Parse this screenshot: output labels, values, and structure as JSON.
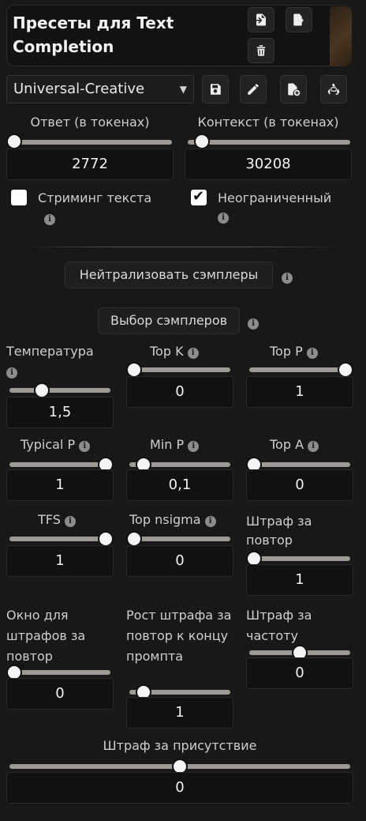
{
  "header": {
    "title": "Пресеты для Text Completion",
    "buttons": [
      "import-icon",
      "export-icon",
      "trash-icon"
    ]
  },
  "preset": {
    "selected": "Universal-Creative",
    "buttons": [
      "save-icon",
      "pencil-icon",
      "new-file-icon",
      "recycle-icon"
    ]
  },
  "response": {
    "label": "Ответ (в токенах)",
    "value": "2772",
    "fraction": 0.05
  },
  "context": {
    "label": "Контекст (в токенах)",
    "value": "30208",
    "fraction": 0.1
  },
  "checkboxes": {
    "streaming": {
      "label": "Стриминг текста",
      "checked": false
    },
    "unlimited": {
      "label": "Неограниченный",
      "checked": true
    }
  },
  "neutralize_label": "Нейтрализовать сэмплеры",
  "sampler_select_label": "Выбор сэмплеров",
  "samplers": [
    {
      "id": "temperature",
      "label": "Температура",
      "value": "1,5",
      "fraction": 0.3
    },
    {
      "id": "topk",
      "label": "Top K",
      "value": "0",
      "fraction": 0.0
    },
    {
      "id": "topp",
      "label": "Top P",
      "value": "1",
      "fraction": 1.0
    },
    {
      "id": "typicalp",
      "label": "Typical P",
      "value": "1",
      "fraction": 1.0
    },
    {
      "id": "minp",
      "label": "Min P",
      "value": "0,1",
      "fraction": 0.1
    },
    {
      "id": "topa",
      "label": "Top A",
      "value": "0",
      "fraction": 0.0
    },
    {
      "id": "tfs",
      "label": "TFS",
      "value": "1",
      "fraction": 1.0
    },
    {
      "id": "topnsigma",
      "label": "Top nsigma",
      "value": "0",
      "fraction": 0.0
    },
    {
      "id": "reppen",
      "label": "Штраф за повтор",
      "value": "1",
      "fraction": 0.0
    },
    {
      "id": "repwindow",
      "label": "Окно для штрафов за повтор",
      "value": "0",
      "fraction": 0.0
    },
    {
      "id": "repslope",
      "label": "Рост штрафа за повтор к концу промпта",
      "value": "1",
      "fraction": 0.1
    },
    {
      "id": "freqpen",
      "label": "Штраф за частоту",
      "value": "0",
      "fraction": 0.5
    },
    {
      "id": "presence",
      "label": "Штраф за присутствие",
      "value": "0",
      "fraction": 0.5
    }
  ],
  "colors": {
    "background": "#181818",
    "track": "#9d9a94",
    "knob": "#f4f4f4",
    "value_box": "#111111"
  }
}
